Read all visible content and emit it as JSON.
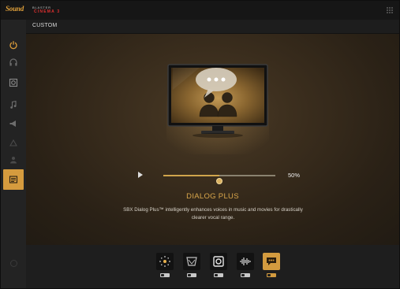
{
  "app": {
    "logo_sound": "Sound",
    "logo_blaster": "BLASTER",
    "logo_cinema": "CINEMA",
    "logo_number": "3"
  },
  "header": {
    "profile": "CUSTOM"
  },
  "sidebar": {
    "items": [
      {
        "icon": "power-icon",
        "active": false
      },
      {
        "icon": "headphone-icon",
        "active": false
      },
      {
        "icon": "speaker-icon",
        "active": false
      },
      {
        "icon": "music-note-icon",
        "active": false
      },
      {
        "icon": "megaphone-icon",
        "active": false
      },
      {
        "icon": "stage-icon",
        "active": false
      },
      {
        "icon": "person-icon",
        "active": false
      },
      {
        "icon": "sbx-icon",
        "active": true
      }
    ]
  },
  "slider": {
    "value_label": "50%",
    "value": 0.5
  },
  "feature": {
    "title": "DIALOG PLUS",
    "description": "SBX Dialog Plus™ intelligently enhances voices in music and movies for drastically clearer vocal range."
  },
  "effects": [
    {
      "name": "surround",
      "icon": "surround-icon",
      "active": false
    },
    {
      "name": "crystalizer",
      "icon": "crystalizer-icon",
      "active": false
    },
    {
      "name": "bass",
      "icon": "bass-icon",
      "active": false
    },
    {
      "name": "smart-volume",
      "icon": "smart-volume-icon",
      "active": false
    },
    {
      "name": "dialog-plus",
      "icon": "dialog-plus-icon",
      "active": true
    }
  ],
  "colors": {
    "accent": "#d39b3f",
    "background": "#1b1b1b",
    "stage": "#3a2d1d"
  }
}
